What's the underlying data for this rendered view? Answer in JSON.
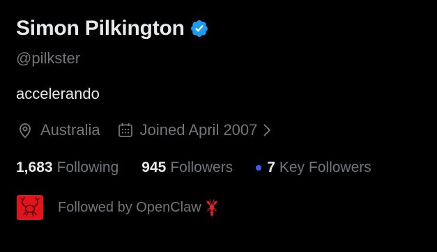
{
  "profile": {
    "display_name": "Simon Pilkington",
    "handle": "@pilkster",
    "bio": "accelerando",
    "location": "Australia",
    "joined": "Joined April 2007",
    "verified_icon": "verified-badge-icon"
  },
  "stats": {
    "following_count": "1,683",
    "following_label": "Following",
    "followers_count": "945",
    "followers_label": "Followers",
    "key_followers_count": "7",
    "key_followers_label": "Key Followers"
  },
  "followed_by": {
    "text": "Followed by OpenClaw",
    "emoji_icon": "lobster-icon",
    "avatar_icon": "lobster-avatar"
  },
  "colors": {
    "background": "#000000",
    "primary_text": "#e7e9ea",
    "secondary_text": "#71767b",
    "verified_blue": "#1d9bf0",
    "key_dot": "#3a5cff",
    "avatar_red": "#e0141c",
    "lobster_red": "#d8232a"
  }
}
